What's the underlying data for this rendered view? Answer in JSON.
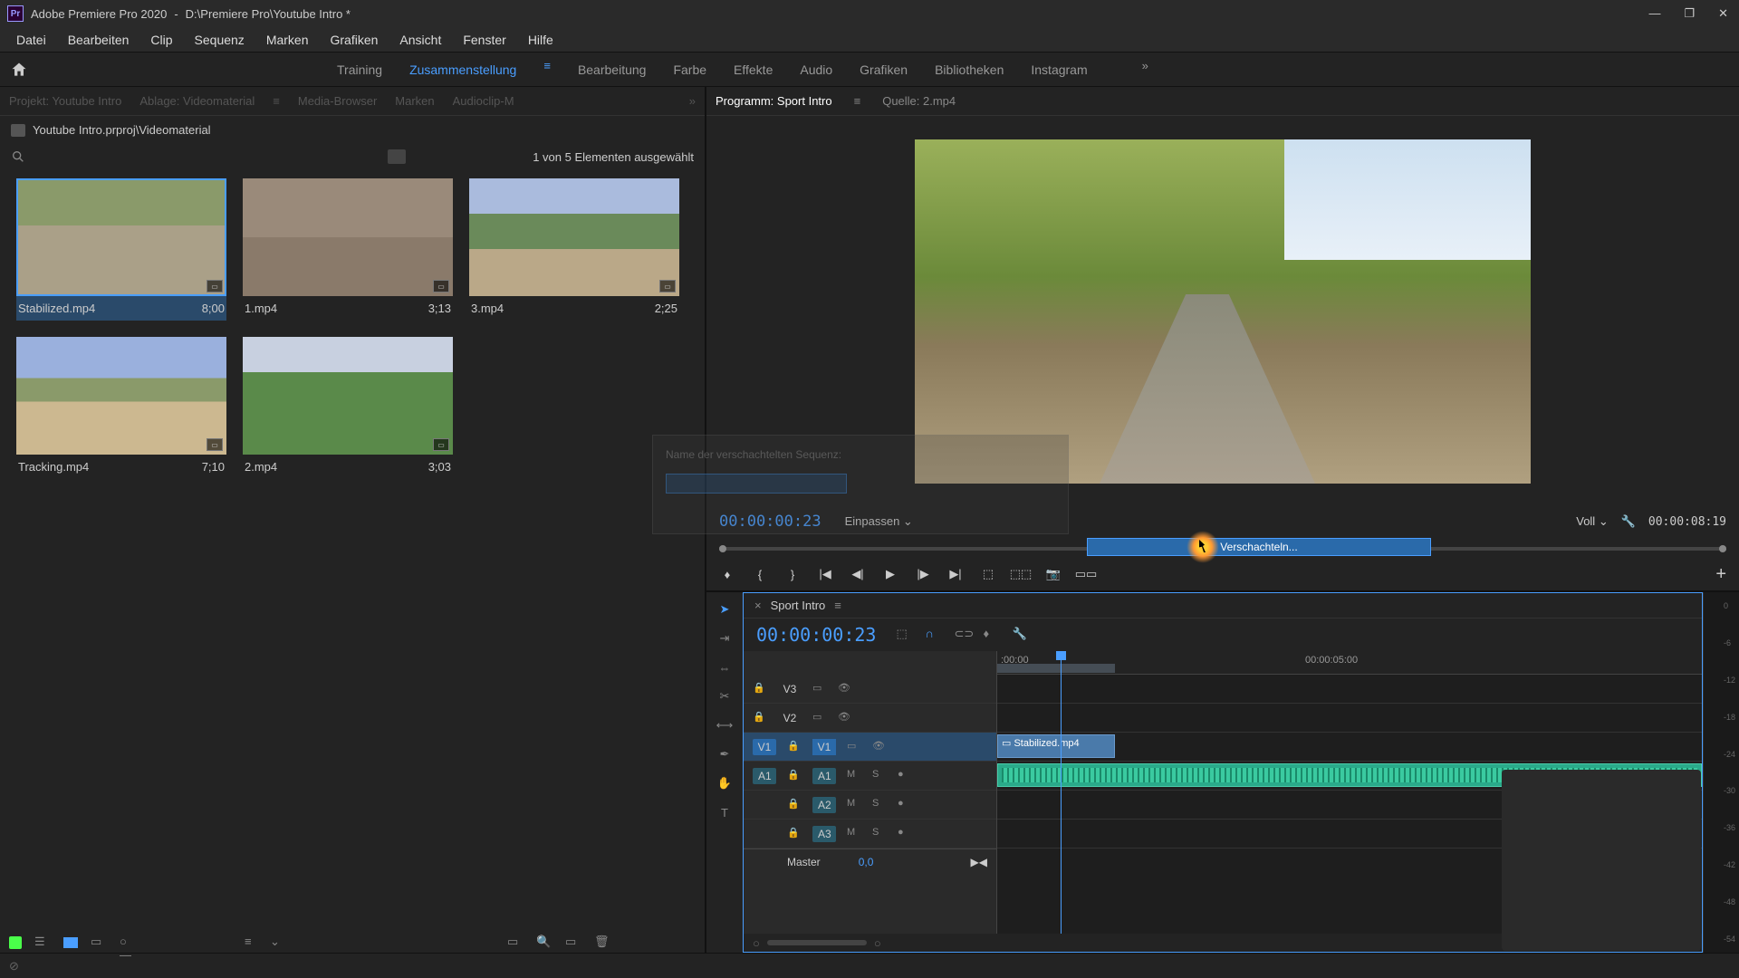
{
  "titlebar": {
    "app": "Adobe Premiere Pro 2020",
    "path": "D:\\Premiere Pro\\Youtube Intro *"
  },
  "menu": [
    "Datei",
    "Bearbeiten",
    "Clip",
    "Sequenz",
    "Marken",
    "Grafiken",
    "Ansicht",
    "Fenster",
    "Hilfe"
  ],
  "workspaces": [
    "Training",
    "Zusammenstellung",
    "Bearbeitung",
    "Farbe",
    "Effekte",
    "Audio",
    "Grafiken",
    "Bibliotheken",
    "Instagram"
  ],
  "active_workspace": "Zusammenstellung",
  "project_panel_tabs": [
    "Projekt: Youtube Intro",
    "Ablage: Videomaterial",
    "Media-Browser",
    "Marken",
    "Audioclip-M"
  ],
  "project_breadcrumb": "Youtube Intro.prproj\\Videomaterial",
  "selection_info": "1 von 5 Elementen ausgewählt",
  "clips": [
    {
      "name": "Stabilized.mp4",
      "dur": "8;00",
      "sel": true,
      "th": "th1"
    },
    {
      "name": "1.mp4",
      "dur": "3;13",
      "sel": false,
      "th": "th2"
    },
    {
      "name": "3.mp4",
      "dur": "2;25",
      "sel": false,
      "th": "th3"
    },
    {
      "name": "Tracking.mp4",
      "dur": "7;10",
      "sel": false,
      "th": "th4"
    },
    {
      "name": "2.mp4",
      "dur": "3;03",
      "sel": false,
      "th": "th5"
    }
  ],
  "program": {
    "tab_active": "Programm: Sport Intro",
    "tab_source": "Quelle: 2.mp4",
    "tc": "00:00:00:23",
    "fit": "Einpassen",
    "quality": "Voll",
    "duration": "00:00:08:19",
    "progress_label": "Verschachteln..."
  },
  "timeline": {
    "name": "Sport Intro",
    "tc": "00:00:00:23",
    "ruler": [
      ":00:00",
      "00:00:05:00"
    ],
    "tracks_v": [
      "V3",
      "V2",
      "V1"
    ],
    "tracks_a": [
      "A1",
      "A2",
      "A3"
    ],
    "src_v": "V1",
    "src_a": "A1",
    "clip_v1": "Stabilized.mp4",
    "master": "Master",
    "master_val": "0,0"
  },
  "dialog": {
    "label": "Name der verschachtelten Sequenz:"
  },
  "meter_marks": [
    "0",
    "-6",
    "-12",
    "-18",
    "-24",
    "-30",
    "-36",
    "-42",
    "-48",
    "-54"
  ]
}
